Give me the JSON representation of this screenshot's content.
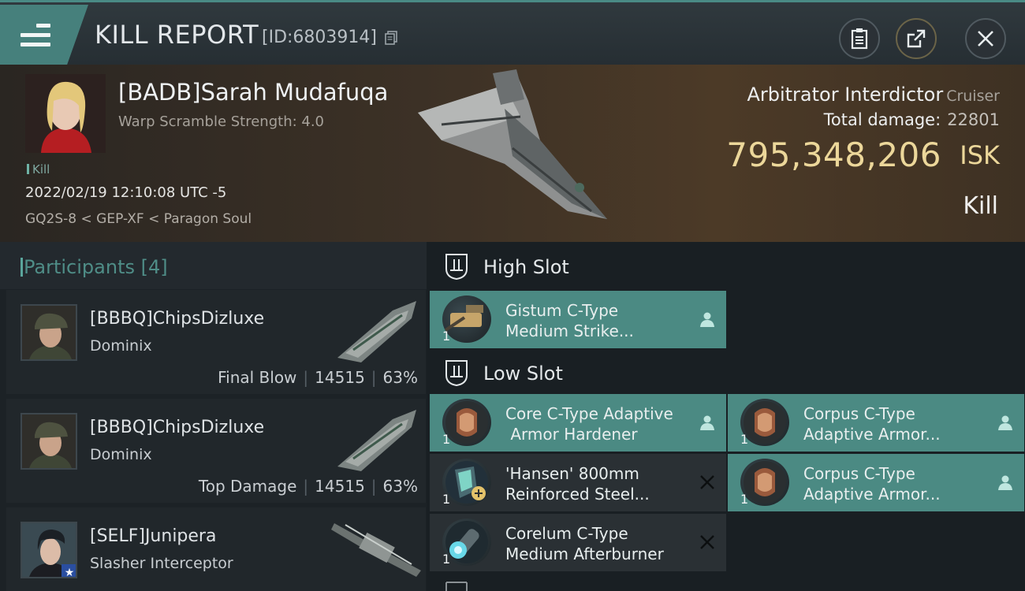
{
  "header": {
    "title": "KILL REPORT",
    "kill_id": "[ID:6803914]",
    "buttons": [
      "clipboard-icon",
      "share-icon",
      "close-icon"
    ]
  },
  "victim": {
    "name": "[BADB]Sarah Mudafuqa",
    "warp_scramble": "Warp Scramble Strength: 4.0",
    "tag": "Kill",
    "datetime": "2022/02/19 12:10:08 UTC -5",
    "location": "GQ2S-8 < GEP-XF < Paragon Soul",
    "ship": "Arbitrator Interdictor",
    "ship_class": "Cruiser",
    "total_damage_label": "Total damage:",
    "total_damage": "22801",
    "isk_value": "795,348,206",
    "isk_unit": "ISK",
    "result": "Kill"
  },
  "participants": {
    "title": "Participants [4]",
    "rows": [
      {
        "name": "[BBBQ]ChipsDizluxe",
        "ship": "Dominix",
        "role": "Final Blow",
        "damage": "14515",
        "percent": "63%"
      },
      {
        "name": "[BBBQ]ChipsDizluxe",
        "ship": "Dominix",
        "role": "Top Damage",
        "damage": "14515",
        "percent": "63%"
      },
      {
        "name": "[SELF]Junipera",
        "ship": "Slasher Interceptor",
        "role": "",
        "damage": "",
        "percent": ""
      }
    ]
  },
  "slots": {
    "high": {
      "title": "High Slot",
      "items": [
        {
          "name": "Gistum C-Type\nMedium Strike...",
          "qty": "1",
          "state": "dropped",
          "icon": "turret-icon"
        }
      ]
    },
    "low": {
      "title": "Low Slot",
      "items": [
        {
          "name": "Core C-Type Adaptive\n Armor Hardener",
          "qty": "1",
          "state": "dropped",
          "icon": "armor-hardener-icon"
        },
        {
          "name": "Corpus C-Type\nAdaptive Armor...",
          "qty": "1",
          "state": "dropped",
          "icon": "armor-hardener-icon"
        },
        {
          "name": "'Hansen' 800mm\nReinforced Steel...",
          "qty": "1",
          "state": "destroyed",
          "icon": "armor-plate-icon"
        },
        {
          "name": "Corpus C-Type\nAdaptive Armor...",
          "qty": "1",
          "state": "dropped",
          "icon": "armor-hardener-icon"
        },
        {
          "name": "Corelum C-Type\nMedium Afterburner",
          "qty": "1",
          "state": "destroyed",
          "icon": "afterburner-icon"
        }
      ]
    }
  },
  "colors": {
    "accent": "#4b8a83",
    "isk": "#ecd79a",
    "participants_title": "#4f8d87"
  }
}
